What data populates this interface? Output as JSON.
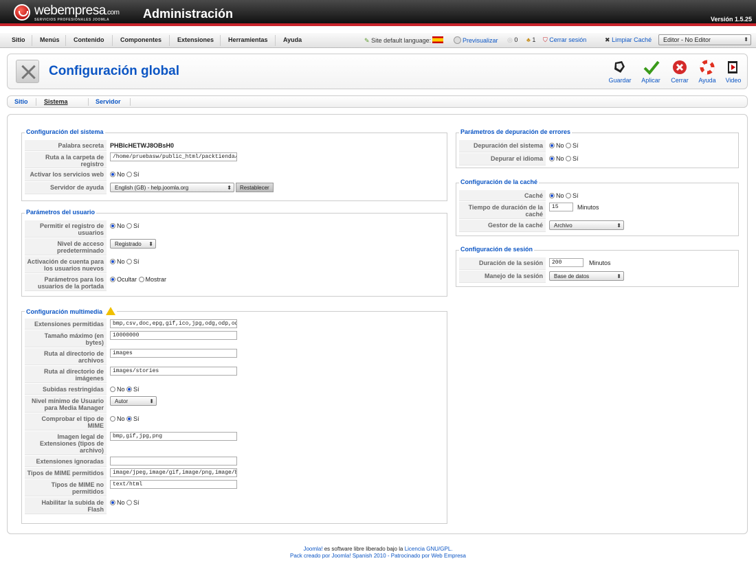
{
  "header": {
    "brand": "webempresa",
    "brand_suffix": ".com",
    "brand_tagline": "SERVICIOS PROFESIONALES JOOMLA",
    "title": "Administración",
    "version": "Versión 1.5.25"
  },
  "menu": {
    "items": [
      "Sitio",
      "Menús",
      "Contenido",
      "Componentes",
      "Extensiones",
      "Herramientas",
      "Ayuda"
    ],
    "language_label": "Site default language:",
    "preview": "Previsualizar",
    "messages_count": "0",
    "users_count": "1",
    "logout": "Cerrar sesión",
    "clear_cache": "Limpiar Caché",
    "editor": "Editor - No Editor"
  },
  "toolbar": {
    "title": "Configuración global",
    "buttons": [
      "Guardar",
      "Aplicar",
      "Cerrar",
      "Ayuda",
      "Video"
    ]
  },
  "tabs": [
    "Sitio",
    "Sistema",
    "Servidor"
  ],
  "system": {
    "legend": "Configuración del sistema",
    "secret_label": "Palabra secreta",
    "secret_value": "PHBlcHETWJ8OBsH0",
    "logpath_label": "Ruta a la carpeta de registro",
    "logpath_value": "/home/pruebasw/public_html/packtienda/lc",
    "webservices_label": "Activar los servicios web",
    "no": "No",
    "si": "Sí",
    "helpserver_label": "Servidor de ayuda",
    "helpserver_value": "English (GB) - help.joomla.org",
    "reset": "Restablecer"
  },
  "users": {
    "legend": "Parámetros del usuario",
    "register_label": "Permitir el registro de usuarios",
    "access_label": "Nivel de acceso predeterminado",
    "access_value": "Registrado",
    "activation_label": "Activación de cuenta para los usuarios nuevos",
    "frontend_label": "Parámetros para los usuarios de la portada",
    "hide": "Ocultar",
    "show": "Mostrar"
  },
  "media": {
    "legend": "Configuración multimedia",
    "ext_label": "Extensiones permitidas",
    "ext_value": "bmp,csv,doc,epg,gif,ico,jpg,odg,odp,ods,odt",
    "maxsize_label": "Tamaño máximo (en bytes)",
    "maxsize_value": "10000000",
    "files_label": "Ruta al directorio de archivos",
    "files_value": "images",
    "images_label": "Ruta al directorio de imágenes",
    "images_value": "images/stories",
    "restrict_label": "Subidas restringidas",
    "minlevel_label": "Nivel mínimo de Usuario para Media Manager",
    "minlevel_value": "Autor",
    "mime_check_label": "Comprobar el tipo de MIME",
    "legal_images_label": "Imagen legal de Extensiones (tipos de archivo)",
    "legal_images_value": "bmp,gif,jpg,png",
    "ignored_label": "Extensiones ignoradas",
    "ignored_value": "",
    "mime_allowed_label": "Tipos de MIME permitidos",
    "mime_allowed_value": "image/jpeg,image/gif,image/png,image/bm",
    "mime_denied_label": "Tipos de MIME no permitidos",
    "mime_denied_value": "text/html",
    "flash_label": "Habilitar la subida de Flash"
  },
  "debug": {
    "legend": "Parámetros de depuración de errores",
    "system_label": "Depuración del sistema",
    "lang_label": "Depurar el idioma"
  },
  "cache": {
    "legend": "Configuración de la caché",
    "cache_label": "Caché",
    "time_label": "Tiempo de duración de la caché",
    "time_value": "15",
    "minutes": "Minutos",
    "handler_label": "Gestor de la caché",
    "handler_value": "Archivo"
  },
  "session": {
    "legend": "Configuración de sesión",
    "lifetime_label": "Duración de la sesión",
    "lifetime_value": "200",
    "minutes": "Minutos",
    "handler_label": "Manejo de la sesión",
    "handler_value": "Base de datos"
  },
  "footer": {
    "joomla": "Joomla!",
    "line1_mid": " es software libre liberado bajo la ",
    "license": "Licencia GNU/GPL.",
    "line2": "Pack creado por Joomla! Spanish 2010 - Patrocinado por Web Empresa"
  },
  "colors": {
    "accent": "#0b55c4",
    "brand_red": "#c8242b"
  }
}
